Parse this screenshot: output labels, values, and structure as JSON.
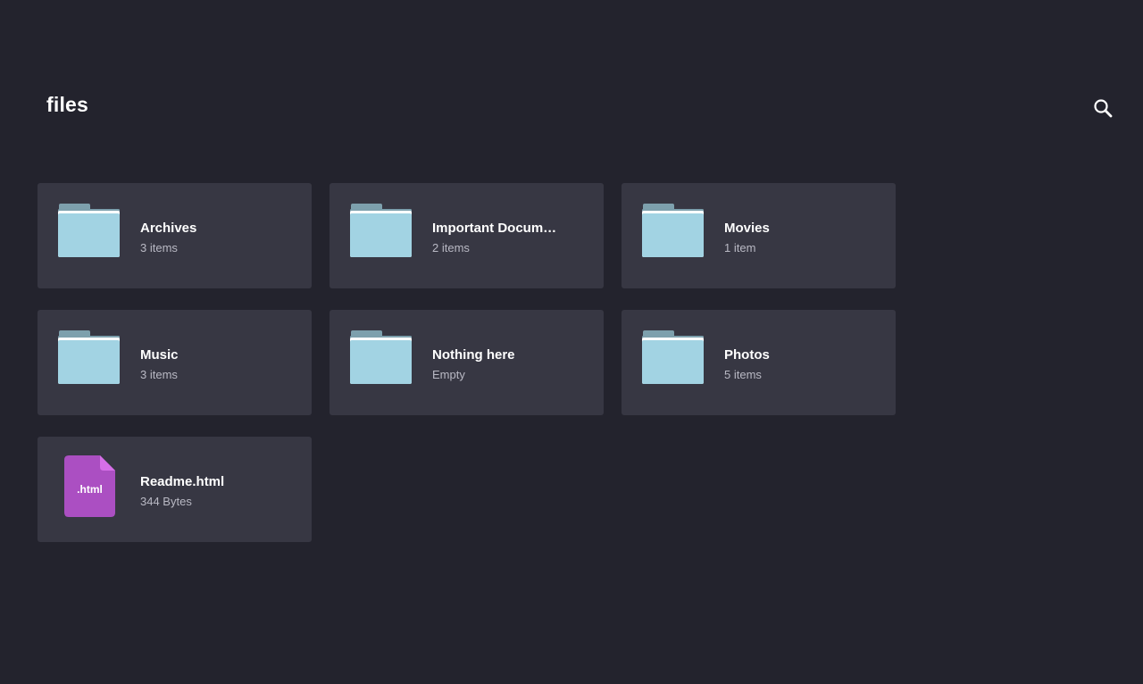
{
  "header": {
    "title": "files",
    "search_icon": "search-icon"
  },
  "colors": {
    "background": "#23232d",
    "card": "#373743",
    "folder": "#a2d3e3",
    "folder_tab": "#7da0ad",
    "html_file": "#ab4fc2",
    "html_file_corner": "#d66fe8"
  },
  "items": [
    {
      "type": "folder",
      "name": "Archives",
      "meta": "3 items",
      "icon": "folder-icon"
    },
    {
      "type": "folder",
      "name": "Important Documents",
      "meta": "2 items",
      "icon": "folder-icon"
    },
    {
      "type": "folder",
      "name": "Movies",
      "meta": "1 item",
      "icon": "folder-icon"
    },
    {
      "type": "folder",
      "name": "Music",
      "meta": "3 items",
      "icon": "folder-icon"
    },
    {
      "type": "folder",
      "name": "Nothing here",
      "meta": "Empty",
      "icon": "folder-icon"
    },
    {
      "type": "folder",
      "name": "Photos",
      "meta": "5 items",
      "icon": "folder-icon"
    },
    {
      "type": "file",
      "name": "Readme.html",
      "meta": "344 Bytes",
      "icon": "html-file-icon",
      "ext_label": ".html"
    }
  ]
}
